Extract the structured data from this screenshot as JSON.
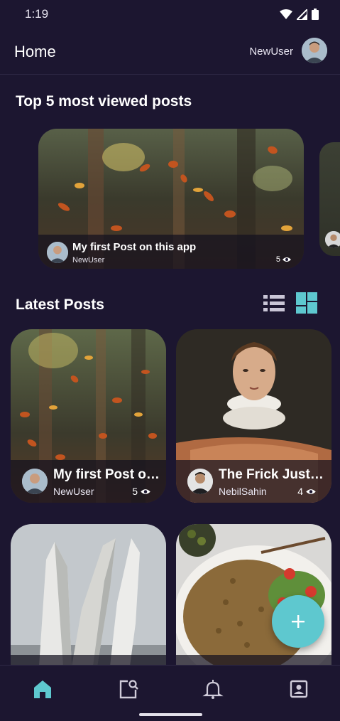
{
  "status_bar": {
    "time": "1:19",
    "icons": [
      "wifi-icon",
      "signal-icon",
      "battery-icon"
    ]
  },
  "app_bar": {
    "title": "Home",
    "username": "NewUser"
  },
  "top_section": {
    "title": "Top 5 most viewed posts",
    "featured": {
      "title": "My first Post on this app",
      "author": "NewUser",
      "views": "5"
    }
  },
  "latest_section": {
    "title": "Latest Posts",
    "toggles": [
      "list-view-icon",
      "grid-view-icon"
    ],
    "posts": [
      {
        "title": "My first Post on this app",
        "author": "NewUser",
        "views": "5"
      },
      {
        "title": "The Frick Justice",
        "author": "NebilSahin",
        "views": "4"
      },
      {
        "title": "",
        "author": "",
        "views": ""
      },
      {
        "title": "",
        "author": "",
        "views": ""
      }
    ]
  },
  "fab": {
    "icon": "plus-icon"
  },
  "bottom_nav": {
    "items": [
      "home-icon",
      "search-posts-icon",
      "notifications-icon",
      "profile-icon"
    ]
  },
  "colors": {
    "background": "#1c1630",
    "accent": "#5ec8cf",
    "active_nav": "#5ec8cf",
    "inactive_nav": "#cfcbd9"
  }
}
